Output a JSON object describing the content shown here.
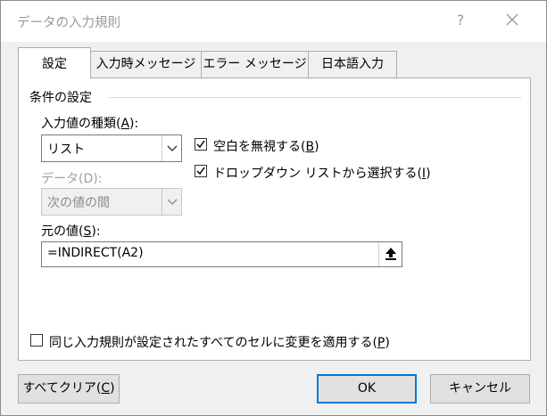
{
  "window": {
    "title": "データの入力規則",
    "help_glyph": "?"
  },
  "tabs": [
    {
      "label": "設定"
    },
    {
      "label": "入力時メッセージ"
    },
    {
      "label": "エラー メッセージ"
    },
    {
      "label": "日本語入力"
    }
  ],
  "settings": {
    "section_label": "条件の設定",
    "allow": {
      "label_prefix": "入力値の種類(",
      "label_key": "A",
      "label_suffix": "):",
      "value": "リスト"
    },
    "data": {
      "label": "データ(D):",
      "value": "次の値の間"
    },
    "ignore_blank": {
      "label_prefix": "空白を無視する(",
      "label_key": "B",
      "label_suffix": ")",
      "checked": true
    },
    "in_cell_dropdown": {
      "label_prefix": "ドロップダウン リストから選択する(",
      "label_key": "I",
      "label_suffix": ")",
      "checked": true
    },
    "source": {
      "label_prefix": "元の値(",
      "label_key": "S",
      "label_suffix": "):",
      "value": "=INDIRECT(A2)"
    },
    "apply_all": {
      "label_prefix": "同じ入力規則が設定されたすべてのセルに変更を適用する(",
      "label_key": "P",
      "label_suffix": ")",
      "checked": false
    }
  },
  "buttons": {
    "clear_prefix": "すべてクリア(",
    "clear_key": "C",
    "clear_suffix": ")",
    "ok": "OK",
    "cancel": "キャンセル"
  },
  "colors": {
    "accent": "#0078d7",
    "panel": "#ffffff",
    "background": "#f0f0f0"
  }
}
